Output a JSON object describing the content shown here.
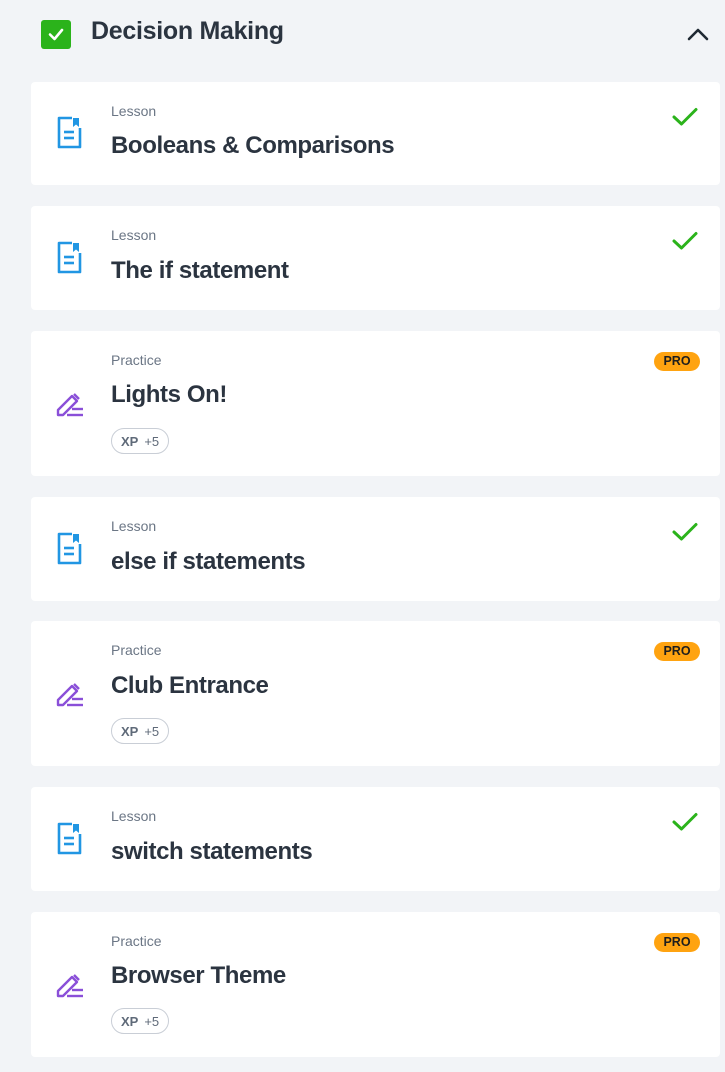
{
  "section": {
    "title": "Decision Making",
    "completed": true
  },
  "items": [
    {
      "type": "Lesson",
      "title": "Booleans & Comparisons",
      "kind": "lesson",
      "status": "completed"
    },
    {
      "type": "Lesson",
      "title": "The if statement",
      "kind": "lesson",
      "status": "completed"
    },
    {
      "type": "Practice",
      "title": "Lights On!",
      "kind": "practice",
      "badge": "PRO",
      "xp_label": "XP",
      "xp_value": "+5"
    },
    {
      "type": "Lesson",
      "title": "else if statements",
      "kind": "lesson",
      "status": "completed"
    },
    {
      "type": "Practice",
      "title": "Club Entrance",
      "kind": "practice",
      "badge": "PRO",
      "xp_label": "XP",
      "xp_value": "+5"
    },
    {
      "type": "Lesson",
      "title": "switch statements",
      "kind": "lesson",
      "status": "completed"
    },
    {
      "type": "Practice",
      "title": "Browser Theme",
      "kind": "practice",
      "badge": "PRO",
      "xp_label": "XP",
      "xp_value": "+5"
    }
  ],
  "colors": {
    "lesson_icon": "#2196e3",
    "practice_icon": "#8a4fd8",
    "check": "#2bb31b",
    "pro_badge": "#ffa310"
  }
}
